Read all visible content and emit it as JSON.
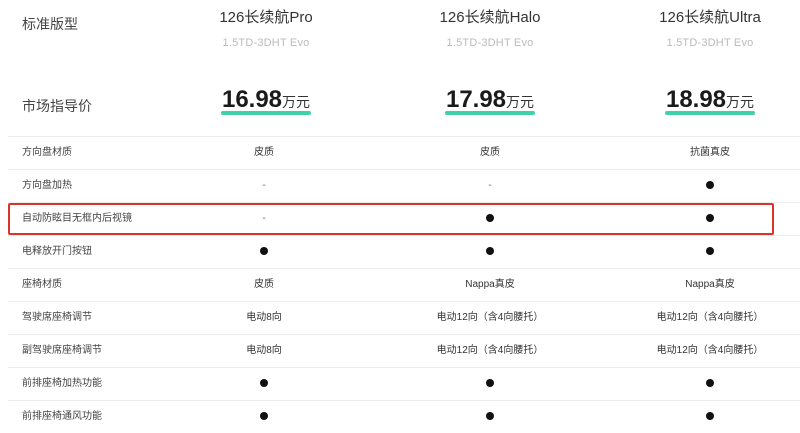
{
  "header": {
    "standard_label": "标准版型",
    "price_label": "市场指导价",
    "models": [
      {
        "name": "126长续航Pro",
        "engine": "1.5TD-3DHT Evo",
        "price": "16.98",
        "unit": "万元"
      },
      {
        "name": "126长续航Halo",
        "engine": "1.5TD-3DHT Evo",
        "price": "17.98",
        "unit": "万元"
      },
      {
        "name": "126长续航Ultra",
        "engine": "1.5TD-3DHT Evo",
        "price": "18.98",
        "unit": "万元"
      }
    ]
  },
  "rows": [
    {
      "label": "方向盘材质",
      "cells": [
        "皮质",
        "皮质",
        "抗菌真皮"
      ]
    },
    {
      "label": "方向盘加热",
      "cells": [
        "-",
        "-",
        "●"
      ]
    },
    {
      "label": "自动防眩目无框内后视镜",
      "cells": [
        "-",
        "●",
        "●"
      ]
    },
    {
      "label": "电释放开门按钮",
      "cells": [
        "●",
        "●",
        "●"
      ]
    },
    {
      "label": "座椅材质",
      "cells": [
        "皮质",
        "Nappa真皮",
        "Nappa真皮"
      ]
    },
    {
      "label": "驾驶席座椅调节",
      "cells": [
        "电动8向",
        "电动12向（含4向腰托）",
        "电动12向（含4向腰托）"
      ]
    },
    {
      "label": "副驾驶席座椅调节",
      "cells": [
        "电动8向",
        "电动12向（含4向腰托）",
        "电动12向（含4向腰托）"
      ]
    },
    {
      "label": "前排座椅加热功能",
      "cells": [
        "●",
        "●",
        "●"
      ]
    },
    {
      "label": "前排座椅通风功能",
      "cells": [
        "●",
        "●",
        "●"
      ]
    }
  ],
  "colors": {
    "accent": "#3fd1a9",
    "highlight_border": "#d9342a"
  }
}
